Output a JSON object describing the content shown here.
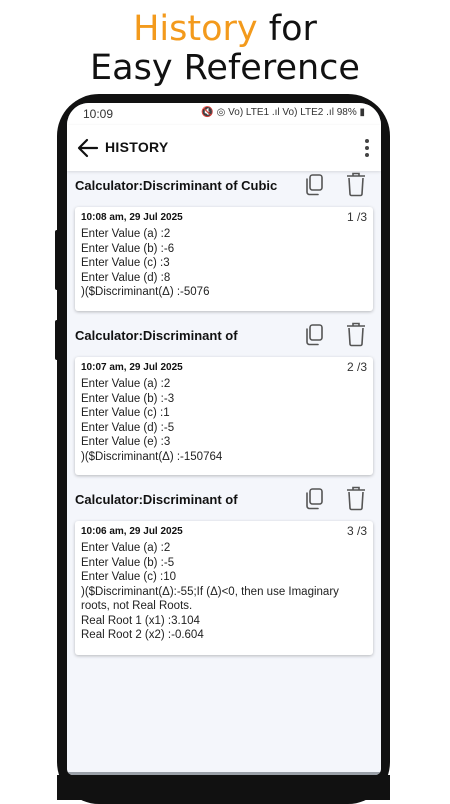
{
  "promo": {
    "highlight": "History",
    "rest1": " for",
    "line2": "Easy Reference"
  },
  "status": {
    "time": "10:09",
    "icons": "🔇 ◎ Vo) LTE1 .ıl Vo) LTE2 .ıl 98% ▮"
  },
  "header": {
    "title": "HISTORY",
    "back_icon": "arrow-left-icon",
    "menu_icon": "more-vert-icon"
  },
  "entries": [
    {
      "title": "Calculator:Discriminant of Cubic",
      "timestamp": "10:08 am, 29 Jul 2025",
      "index": "1 /3",
      "lines": [
        "Enter Value (a) :2",
        "Enter Value (b) :-6",
        "Enter Value (c) :3",
        "Enter Value (d) :8",
        ")($Discriminant(Δ) :-5076"
      ]
    },
    {
      "title": "Calculator:Discriminant of",
      "timestamp": "10:07 am, 29 Jul 2025",
      "index": "2 /3",
      "lines": [
        "Enter Value (a) :2",
        "Enter Value (b) :-3",
        "Enter Value (c) :1",
        "Enter Value (d) :-5",
        "Enter Value (e) :3",
        ")($Discriminant(Δ) :-150764"
      ]
    },
    {
      "title": "Calculator:Discriminant of",
      "timestamp": "10:06 am, 29 Jul 2025",
      "index": "3 /3",
      "lines": [
        "Enter Value (a) :2",
        "Enter Value (b) :-5",
        "Enter Value (c) :10",
        ")($Discriminant(Δ):-55;If (Δ)<0, then use Imaginary roots, not Real Roots.",
        "Real Root 1 (x1) :3.104",
        "Real Root 2 (x2) :-0.604"
      ]
    }
  ],
  "icons": {
    "copy": "copy-icon",
    "delete": "trash-icon"
  },
  "colors": {
    "accent": "#f39a1c",
    "screen_bg": "#f4f6fb",
    "card_bg": "#ffffff"
  }
}
